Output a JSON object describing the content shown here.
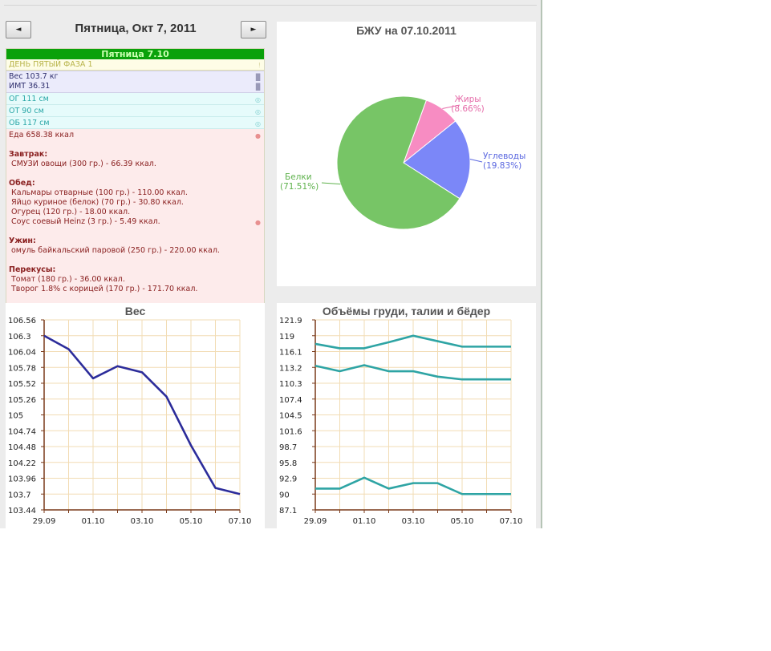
{
  "nav": {
    "prev_label": "◄",
    "next_label": "►",
    "date_title": "Пятница, Окт 7, 2011"
  },
  "diary": {
    "header": "Пятница 7.10",
    "phase": "ДЕНЬ ПЯТЫЙ ФАЗА 1",
    "weight": "Вес 103.7 кг",
    "bmi": "ИМТ 36.31",
    "measurements": [
      "ОГ 111 см",
      "ОТ 90 см",
      "ОБ 117 см"
    ],
    "food_total": "Еда 658.38 ккал",
    "meals": [
      {
        "title": "Завтрак:",
        "items": [
          "СМУЗИ овощи (300 гр.) - 66.39 ккал."
        ]
      },
      {
        "title": "Обед:",
        "items": [
          "Кальмары отварные (100 гр.) - 110.00 ккал.",
          "Яйцо куриное (белок) (70 гр.) - 30.80 ккал.",
          "Огурец (120 гр.) - 18.00 ккал.",
          "Соус соевый Heinz (3 гр.) - 5.49 ккал."
        ]
      },
      {
        "title": "Ужин:",
        "items": [
          "омуль байкальский паровой (250 гр.) - 220.00 ккал."
        ]
      },
      {
        "title": "Перекусы:",
        "items": [
          "Томат (180 гр.) - 36.00 ккал.",
          "Творог 1.8% с корицей (170 гр.) - 171.70 ккал."
        ]
      }
    ]
  },
  "colors": {
    "header_green": "#0aa10a",
    "weight_line": "#2c2c9a",
    "volume_line": "#2ea4a4",
    "protein": "#77c566",
    "fat": "#f78cc2",
    "carb": "#7b87f8"
  },
  "chart_data": [
    {
      "type": "pie",
      "title": "БЖУ на 07.10.2011",
      "slices": [
        {
          "name": "Белки",
          "value": 71.51,
          "label": "(71.51%)",
          "color": "#77c566"
        },
        {
          "name": "Жиры",
          "value": 8.66,
          "label": "(8.66%)",
          "color": "#f78cc2"
        },
        {
          "name": "Углеводы",
          "value": 19.83,
          "label": "(19.83%)",
          "color": "#7b87f8"
        }
      ]
    },
    {
      "type": "line",
      "title": "Вес",
      "x": [
        "29.09",
        "30.09",
        "01.10",
        "02.10",
        "03.10",
        "04.10",
        "05.10",
        "06.10",
        "07.10"
      ],
      "x_tick_labels": [
        "29.09",
        "01.10",
        "03.10",
        "05.10",
        "07.10"
      ],
      "series": [
        {
          "values": [
            106.3,
            106.08,
            105.6,
            105.8,
            105.7,
            105.3,
            104.5,
            103.8,
            103.7
          ]
        }
      ],
      "y_ticks": [
        "106.56",
        "106.3",
        "106.04",
        "105.78",
        "105.52",
        "105.26",
        "105",
        "104.74",
        "104.48",
        "104.22",
        "103.96",
        "103.7",
        "103.44"
      ],
      "ylim": [
        103.44,
        106.56
      ],
      "grid": true
    },
    {
      "type": "line",
      "title": "Объёмы груди, талии и бёдер",
      "x": [
        "29.09",
        "30.09",
        "01.10",
        "02.10",
        "03.10",
        "04.10",
        "05.10",
        "06.10",
        "07.10"
      ],
      "x_tick_labels": [
        "29.09",
        "01.10",
        "03.10",
        "05.10",
        "07.10"
      ],
      "series": [
        {
          "values": [
            117.5,
            116.7,
            116.7,
            117.8,
            119,
            118,
            117,
            117,
            117
          ]
        },
        {
          "values": [
            113.5,
            112.5,
            113.6,
            112.5,
            112.5,
            111.5,
            111,
            111,
            111
          ]
        },
        {
          "values": [
            91,
            91,
            93,
            91,
            92,
            92,
            90,
            90,
            90
          ]
        }
      ],
      "y_ticks": [
        "121.9",
        "119",
        "116.1",
        "113.2",
        "110.3",
        "107.4",
        "104.5",
        "101.6",
        "98.7",
        "95.8",
        "92.9",
        "90",
        "87.1"
      ],
      "ylim": [
        87.1,
        121.9
      ],
      "grid": true
    }
  ]
}
